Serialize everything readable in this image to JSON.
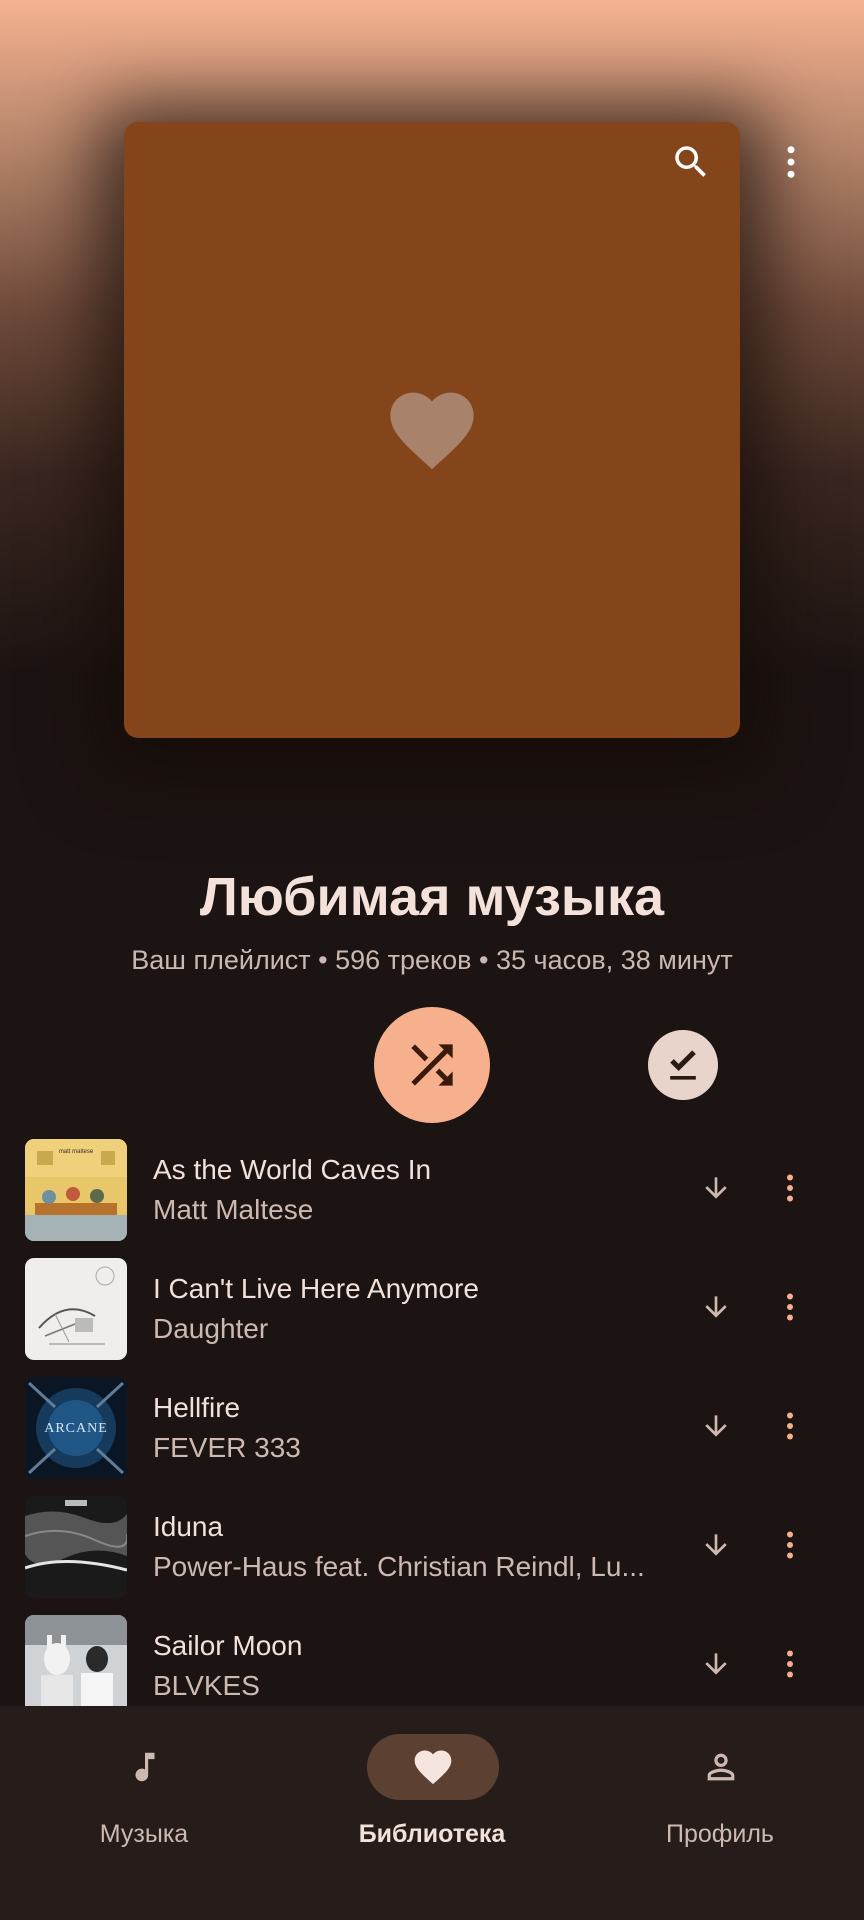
{
  "playlist": {
    "title": "Любимая музыка",
    "subtitle": "Ваш плейлист • 596 треков • 35 часов, 38 минут",
    "cover_color": "#84451b",
    "cover_icon": "heart-icon"
  },
  "header": {
    "search_icon": "search-icon",
    "more_icon": "more-vert-icon"
  },
  "actions": {
    "shuffle_icon": "shuffle-icon",
    "download_all_icon": "download-done-icon",
    "accent": "#f6b08e"
  },
  "tracks": [
    {
      "title": "As the World Caves In",
      "artist": "Matt Maltese"
    },
    {
      "title": "I Can't Live Here Anymore",
      "artist": "Daughter"
    },
    {
      "title": "Hellfire",
      "artist": "FEVER 333"
    },
    {
      "title": "Iduna",
      "artist": "Power-Haus feat. Christian Reindl, Lu..."
    },
    {
      "title": "Sailor Moon",
      "artist": "BLVKES"
    }
  ],
  "nav": {
    "items": [
      {
        "label": "Музыка",
        "icon": "music-note-icon"
      },
      {
        "label": "Библиотека",
        "icon": "heart-icon",
        "active": true
      },
      {
        "label": "Профиль",
        "icon": "person-icon"
      }
    ]
  }
}
